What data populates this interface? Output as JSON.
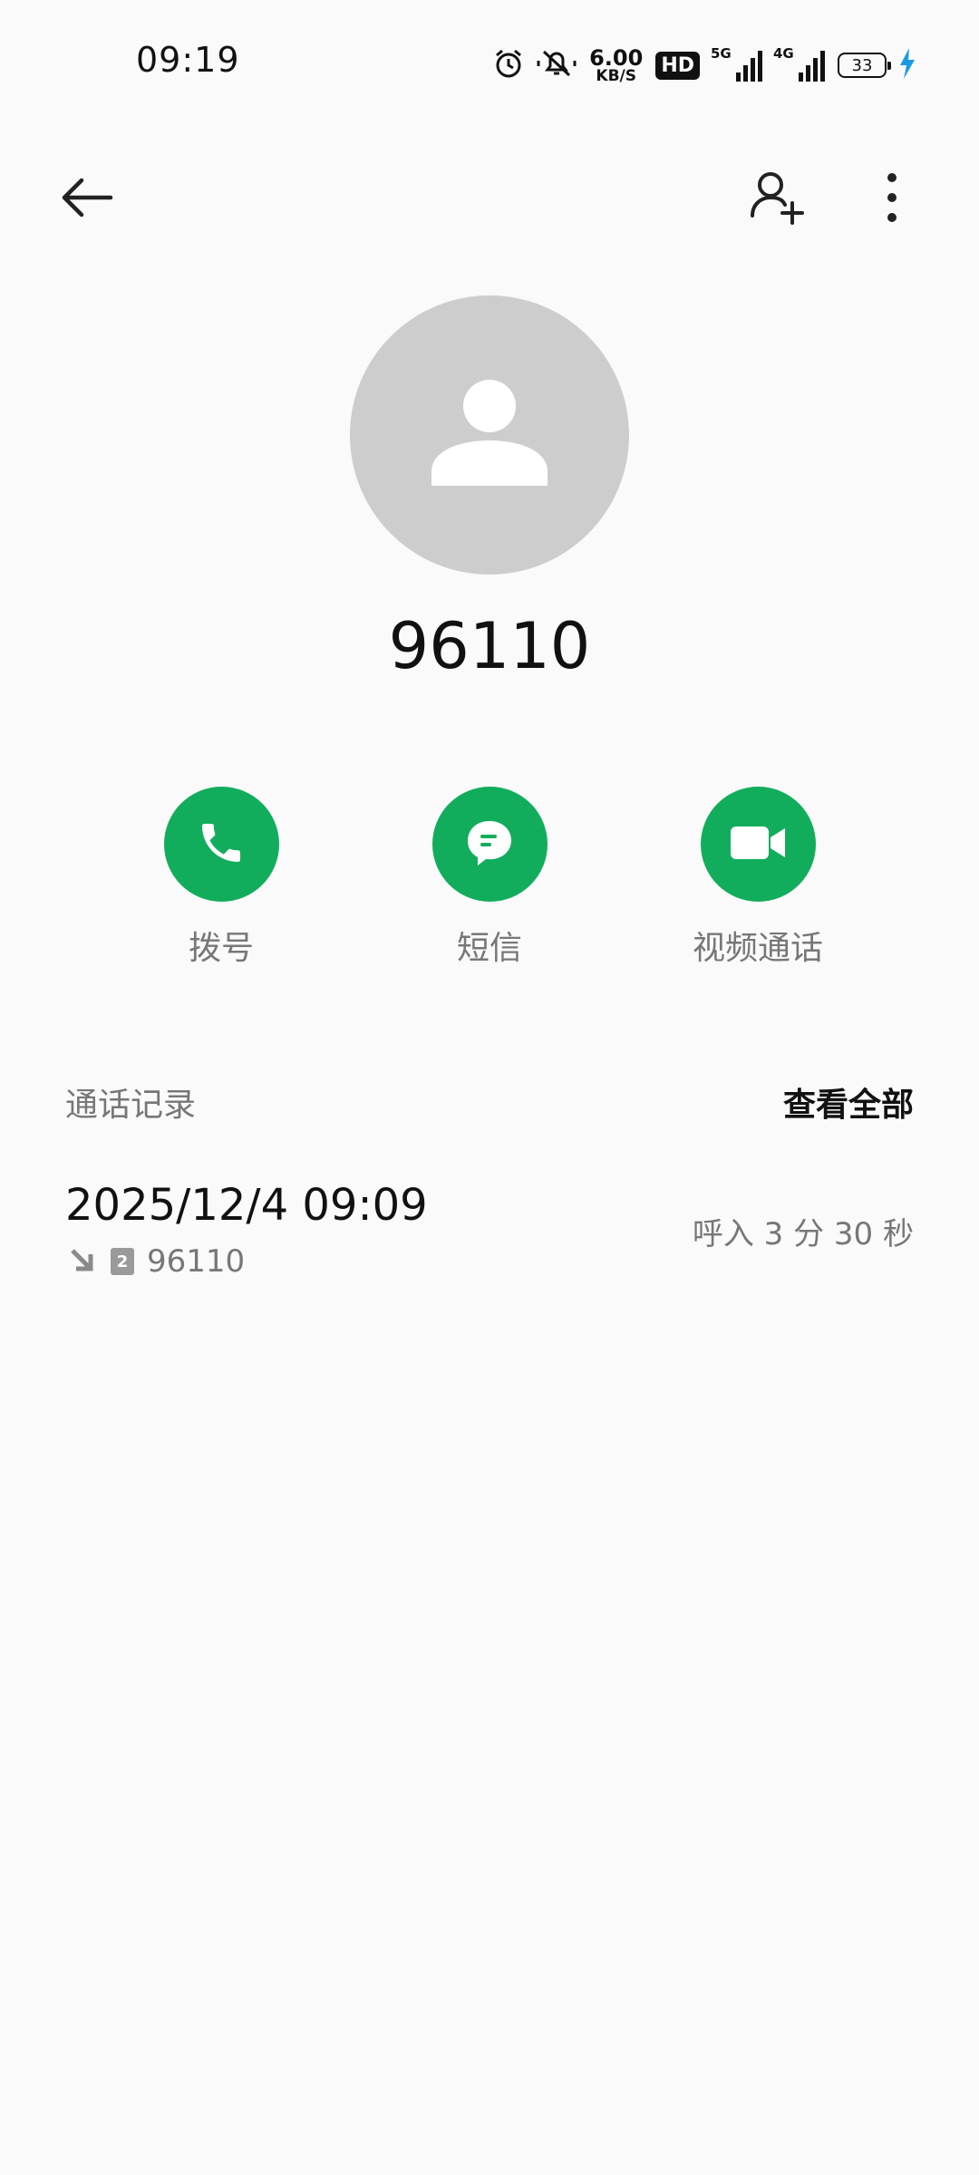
{
  "status_bar": {
    "time": "09:19",
    "net_speed_value": "6.00",
    "net_speed_unit": "KB/S",
    "hd_label": "HD",
    "signal1_label": "5G",
    "signal2_label": "4G",
    "battery_level": "33",
    "icons": [
      "alarm-icon",
      "mute-icon",
      "hd-icon",
      "signal-icon",
      "battery-icon",
      "charging-icon"
    ]
  },
  "top_bar": {
    "icons": [
      "back-arrow-icon",
      "add-contact-icon",
      "more-vertical-icon"
    ]
  },
  "contact": {
    "avatar_icon": "person-icon",
    "number": "96110"
  },
  "actions": [
    {
      "label": "拨号",
      "icon": "phone-icon"
    },
    {
      "label": "短信",
      "icon": "message-icon"
    },
    {
      "label": "视频通话",
      "icon": "video-camera-icon"
    }
  ],
  "colors": {
    "accent_green": "#12ad5c",
    "background": "#fafafa",
    "avatar_gray": "#cdcdcd"
  },
  "call_log": {
    "title": "通话记录",
    "view_all": "查看全部",
    "items": [
      {
        "datetime": "2025/12/4 09:09",
        "direction_icon": "incoming-call-arrow-icon",
        "sim": "2",
        "number": "96110",
        "detail": "呼入  3 分 30 秒"
      }
    ]
  }
}
